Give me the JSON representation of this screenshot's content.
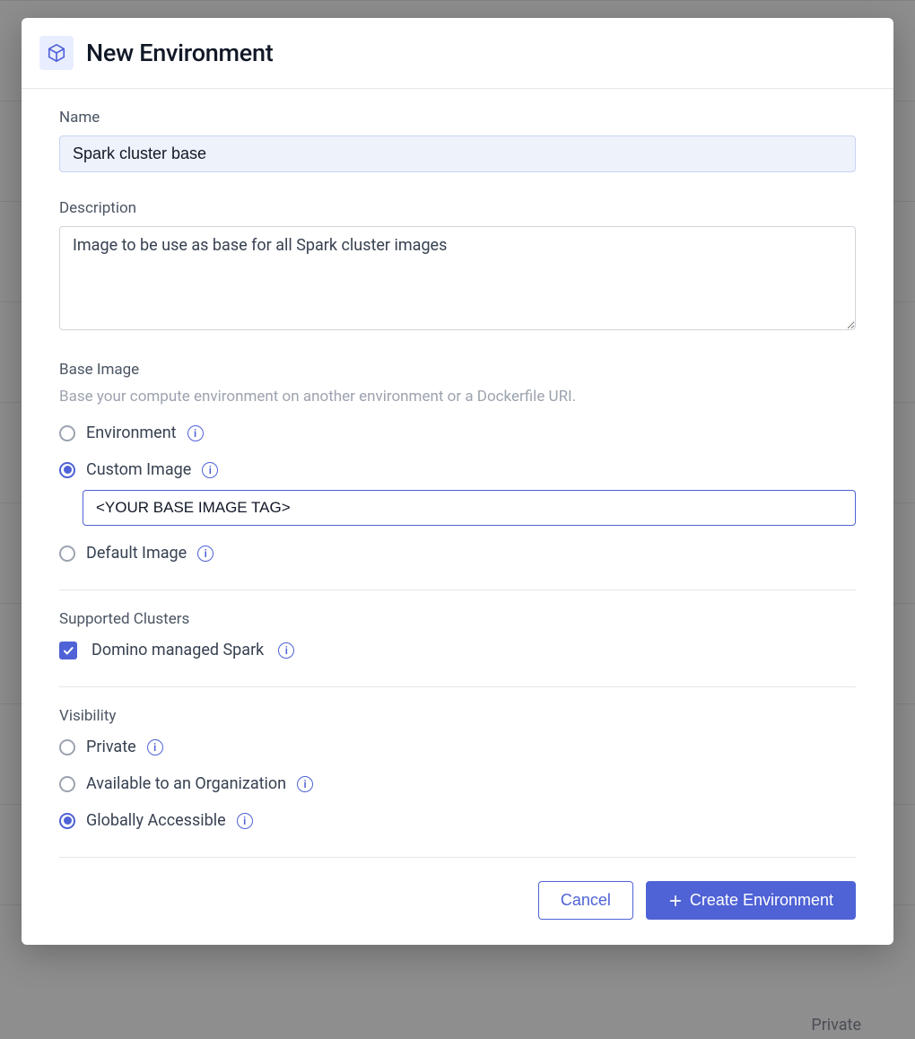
{
  "modal": {
    "title": "New Environment"
  },
  "name": {
    "label": "Name",
    "value": "Spark cluster base"
  },
  "description": {
    "label": "Description",
    "value": "Image to be use as base for all Spark cluster images"
  },
  "baseImage": {
    "label": "Base Image",
    "sublabel": "Base your compute environment on another environment or a Dockerfile URI.",
    "options": {
      "environment": {
        "label": "Environment",
        "checked": false
      },
      "custom": {
        "label": "Custom Image",
        "checked": true,
        "value": "<YOUR BASE IMAGE TAG>"
      },
      "default": {
        "label": "Default Image",
        "checked": false
      }
    }
  },
  "supportedClusters": {
    "label": "Supported Clusters",
    "spark": {
      "label": "Domino managed Spark",
      "checked": true
    }
  },
  "visibility": {
    "label": "Visibility",
    "options": {
      "private": {
        "label": "Private",
        "checked": false
      },
      "org": {
        "label": "Available to an Organization",
        "checked": false
      },
      "global": {
        "label": "Globally Accessible",
        "checked": true
      }
    }
  },
  "footer": {
    "cancel": "Cancel",
    "create": "Create Environment"
  },
  "background": {
    "private_label": "Private"
  }
}
